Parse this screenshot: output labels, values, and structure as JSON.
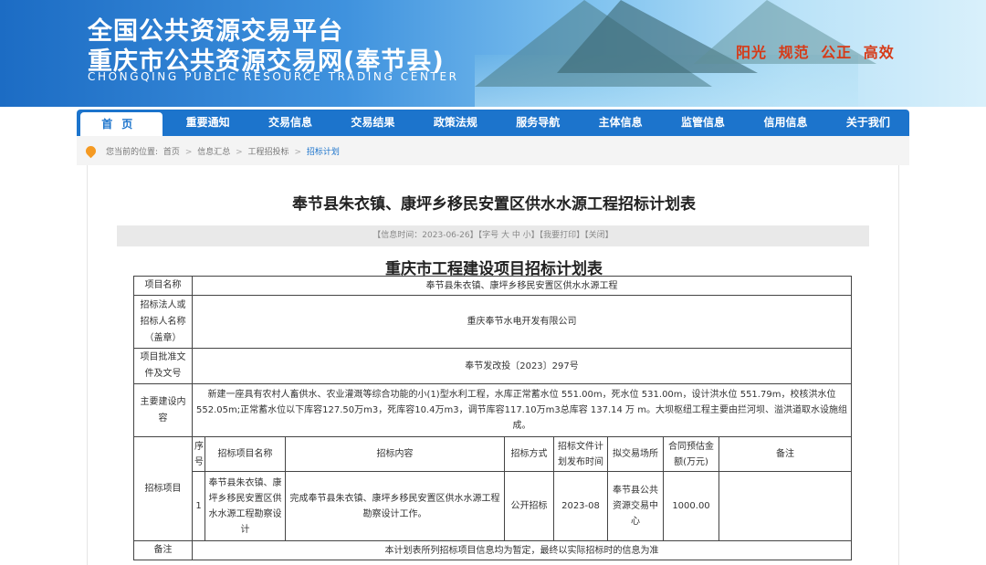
{
  "header": {
    "title_line1": "全国公共资源交易平台",
    "title_line2": "重庆市公共资源交易网(奉节县)",
    "title_en": "CHONGQING PUBLIC RESOURCE TRADING CENTER",
    "slogan": "阳光 规范 公正 高效"
  },
  "nav": {
    "items": [
      "首页",
      "重要通知",
      "交易信息",
      "交易结果",
      "政策法规",
      "服务导航",
      "主体信息",
      "监管信息",
      "信用信息",
      "关于我们"
    ]
  },
  "breadcrumb": {
    "prefix": "您当前的位置:",
    "items": [
      "首页",
      "信息汇总",
      "工程招投标",
      "招标计划"
    ]
  },
  "article": {
    "title": "奉节县朱衣镇、康坪乡移民安置区供水水源工程招标计划表",
    "info_bar": "【信息时间：2023-06-26】【字号 大 中 小】【我要打印】【关闭】"
  },
  "document": {
    "title": "重庆市工程建设项目招标计划表",
    "project_name_label": "项目名称",
    "project_name": "奉节县朱衣镇、康坪乡移民安置区供水水源工程",
    "tenderer_label": "招标法人或招标人名称（盖章）",
    "tenderer": "重庆奉节水电开发有限公司",
    "approval_label": "项目批准文件及文号",
    "approval": "奉节发改投〔2023〕297号",
    "content_label": "主要建设内容",
    "content": "新建一座具有农村人畜供水、农业灌溉等综合功能的小(1)型水利工程，水库正常蓄水位 551.00m，死水位 531.00m，设计洪水位 551.79m，校核洪水位 552.05m;正常蓄水位以下库容127.50万m3，死库容10.4万m3，调节库容117.10万m3总库容 137.14 万 m。大坝枢纽工程主要由拦河坝、溢洪道取水设施组成。",
    "items_label": "招标项目",
    "columns": [
      "序号",
      "招标项目名称",
      "招标内容",
      "招标方式",
      "招标文件计划发布时间",
      "拟交易场所",
      "合同预估金额(万元)",
      "备注"
    ],
    "rows": [
      {
        "no": "1",
        "name": "奉节县朱衣镇、康坪乡移民安置区供水水源工程勘察设计",
        "content": "完成奉节县朱衣镇、康坪乡移民安置区供水水源工程勘察设计工作。",
        "method": "公开招标",
        "date": "2023-08",
        "venue": "奉节县公共资源交易中心",
        "amount": "1000.00",
        "remark": ""
      }
    ],
    "note_label": "备注",
    "note": "本计划表所列招标项目信息均为暂定，最终以实际招标时的信息为准"
  }
}
